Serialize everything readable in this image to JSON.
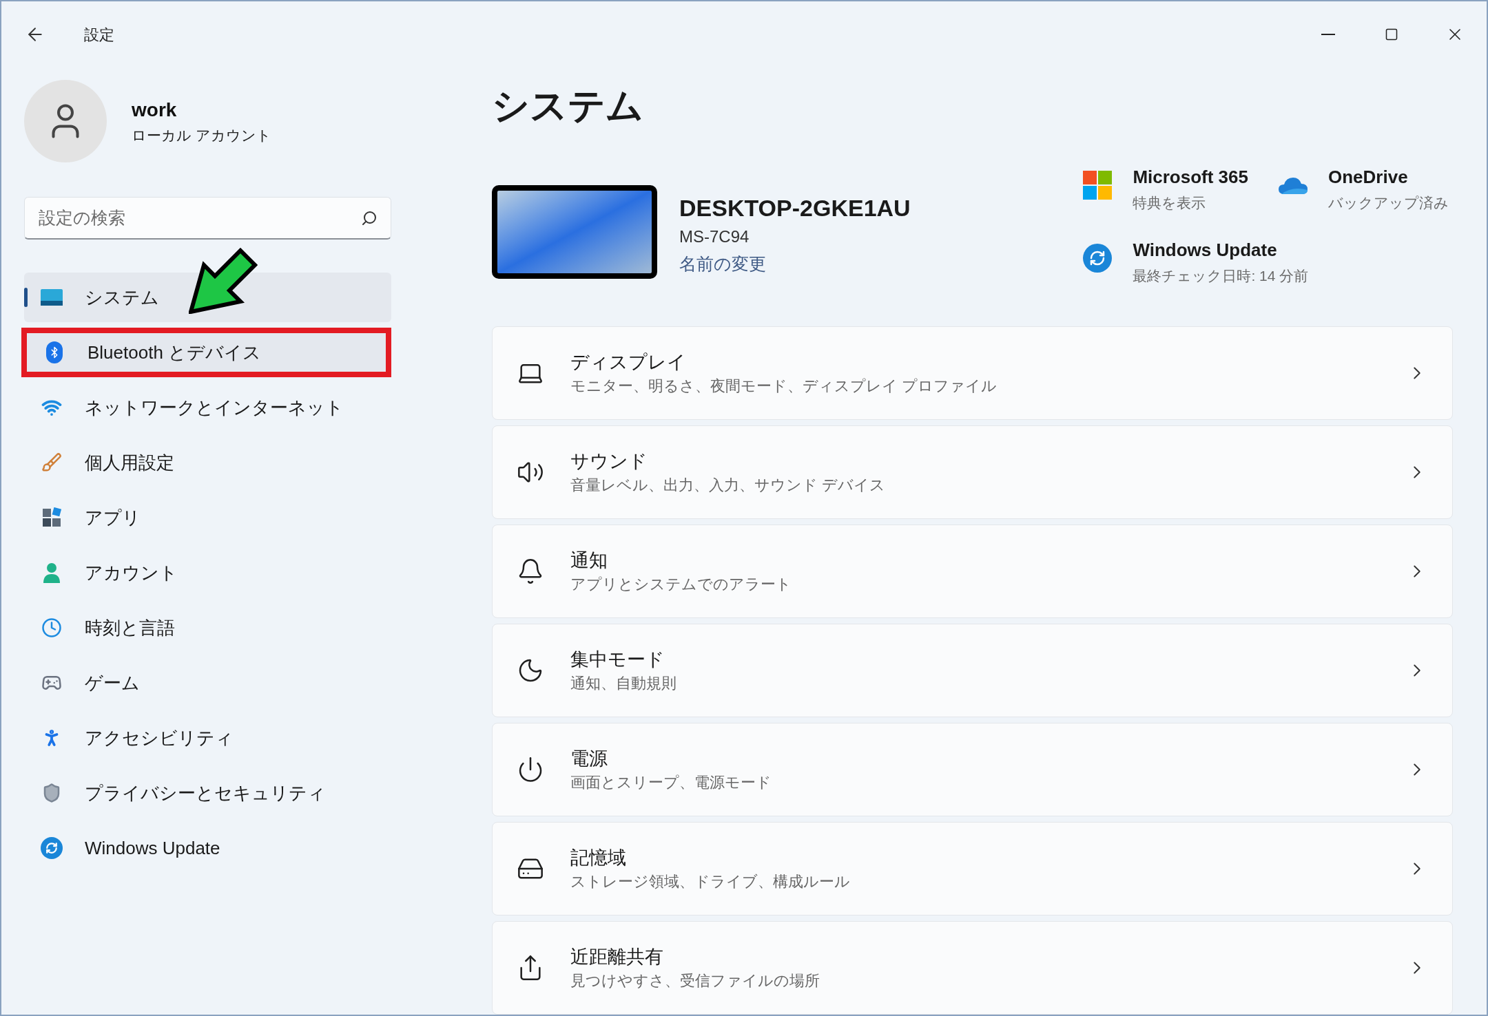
{
  "window": {
    "title": "設定"
  },
  "account": {
    "name": "work",
    "type": "ローカル アカウント"
  },
  "search": {
    "placeholder": "設定の検索"
  },
  "nav": [
    {
      "label": "システム",
      "selected": true,
      "highlighted": false
    },
    {
      "label": "Bluetooth とデバイス",
      "selected": false,
      "highlighted": true
    },
    {
      "label": "ネットワークとインターネット",
      "selected": false,
      "highlighted": false
    },
    {
      "label": "個人用設定",
      "selected": false,
      "highlighted": false
    },
    {
      "label": "アプリ",
      "selected": false,
      "highlighted": false
    },
    {
      "label": "アカウント",
      "selected": false,
      "highlighted": false
    },
    {
      "label": "時刻と言語",
      "selected": false,
      "highlighted": false
    },
    {
      "label": "ゲーム",
      "selected": false,
      "highlighted": false
    },
    {
      "label": "アクセシビリティ",
      "selected": false,
      "highlighted": false
    },
    {
      "label": "プライバシーとセキュリティ",
      "selected": false,
      "highlighted": false
    },
    {
      "label": "Windows Update",
      "selected": false,
      "highlighted": false
    }
  ],
  "page_title": "システム",
  "device": {
    "name": "DESKTOP-2GKE1AU",
    "model": "MS-7C94",
    "rename_link": "名前の変更"
  },
  "quick_links": [
    {
      "title": "Microsoft 365",
      "subtitle": "特典を表示"
    },
    {
      "title": "OneDrive",
      "subtitle": "バックアップ済み"
    },
    {
      "title": "Windows Update",
      "subtitle": "最終チェック日時: 14 分前"
    }
  ],
  "cards": [
    {
      "title": "ディスプレイ",
      "subtitle": "モニター、明るさ、夜間モード、ディスプレイ プロファイル"
    },
    {
      "title": "サウンド",
      "subtitle": "音量レベル、出力、入力、サウンド デバイス"
    },
    {
      "title": "通知",
      "subtitle": "アプリとシステムでのアラート"
    },
    {
      "title": "集中モード",
      "subtitle": "通知、自動規則"
    },
    {
      "title": "電源",
      "subtitle": "画面とスリープ、電源モード"
    },
    {
      "title": "記憶域",
      "subtitle": "ストレージ領域、ドライブ、構成ルール"
    },
    {
      "title": "近距離共有",
      "subtitle": "見つけやすさ、受信ファイルの場所"
    }
  ]
}
